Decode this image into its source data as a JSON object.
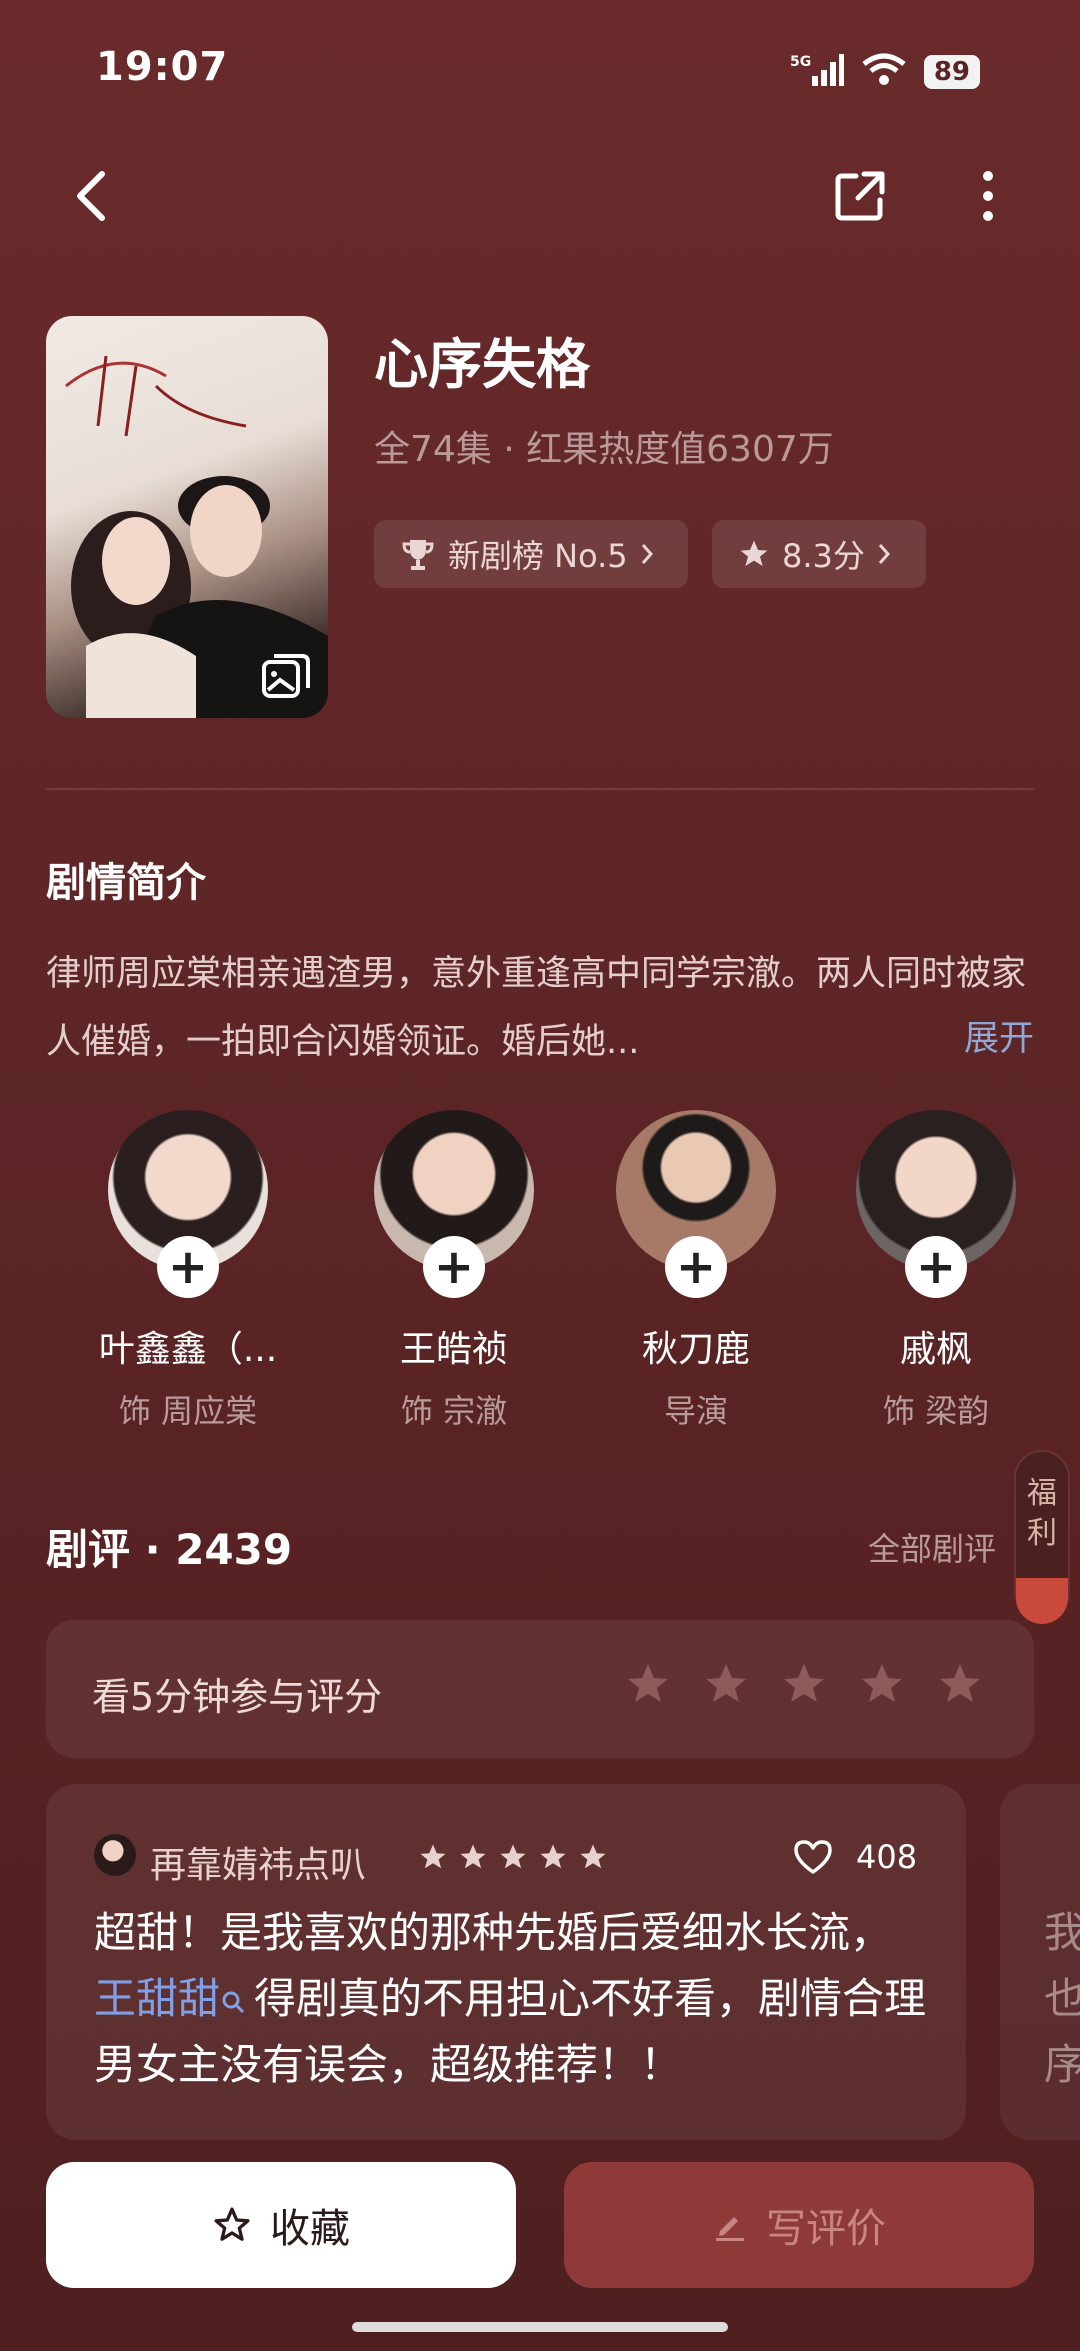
{
  "status": {
    "time": "19:07",
    "network": "5G",
    "battery": "89"
  },
  "drama": {
    "title": "心序失格",
    "subtitle": "全74集 · 红果热度值6307万",
    "rank_chip": "新剧榜 No.5",
    "score_chip": "8.3分"
  },
  "synopsis": {
    "heading": "剧情简介",
    "text": "律师周应棠相亲遇渣男，意外重逢高中同学宗澈。两人同时被家人催婚，一拍即合闪婚领证。婚后她...",
    "expand": "展开"
  },
  "cast": [
    {
      "name": "叶鑫鑫（...",
      "role": "饰 周应棠"
    },
    {
      "name": "王皓祯",
      "role": "饰 宗澈"
    },
    {
      "name": "秋刀鹿",
      "role": "导演"
    },
    {
      "name": "戚枫",
      "role": "饰 梁韵"
    }
  ],
  "reviews": {
    "heading": "剧评 · 2439",
    "all_link": "全部剧评",
    "rate_prompt": "看5分钟参与评分",
    "side_tab": "福利",
    "item": {
      "user": "再靠婧祎点叭",
      "likes": "408",
      "text_part1": "超甜！是我喜欢的那种先婚后爱细水长流，",
      "mention": "王甜甜",
      "text_part2": "得剧真的不用担心不好看，剧情合理男女主没有误会，超级推荐！！"
    },
    "peek_text": "我\n也\n序"
  },
  "actions": {
    "favorite": "收藏",
    "write_review": "写评价"
  },
  "colors": {
    "background": "#5f2627",
    "accent_link": "#8fa8d6",
    "write_button": "#8e3a38"
  }
}
